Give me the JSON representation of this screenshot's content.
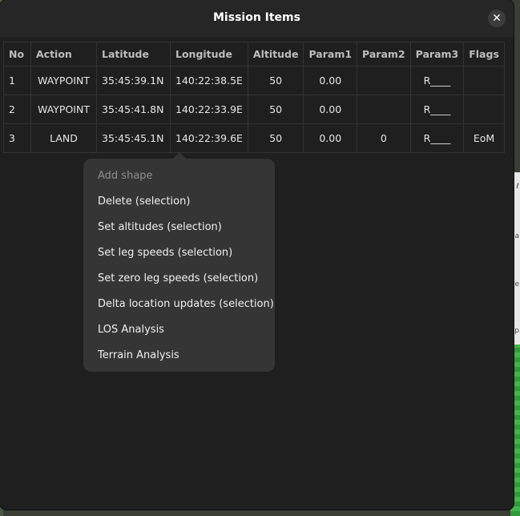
{
  "dialog": {
    "title": "Mission Items",
    "close_glyph": "✕"
  },
  "table": {
    "headers": [
      "No",
      "Action",
      "Latitude",
      "Longitude",
      "Altitude",
      "Param1",
      "Param2",
      "Param3",
      "Flags"
    ],
    "rows": [
      [
        "1",
        "WAYPOINT",
        "35:45:39.1N",
        "140:22:38.5E",
        "50",
        "0.00",
        "",
        "R____",
        ""
      ],
      [
        "2",
        "WAYPOINT",
        "35:45:41.8N",
        "140:22:33.9E",
        "50",
        "0.00",
        "",
        "R____",
        ""
      ],
      [
        "3",
        "LAND",
        "35:45:45.1N",
        "140:22:39.6E",
        "50",
        "0.00",
        "0",
        "R____",
        "EoM"
      ]
    ]
  },
  "context_menu": {
    "items": [
      "Add shape",
      "Delete (selection)",
      "Set altitudes (selection)",
      "Set leg speeds  (selection)",
      "Set zero leg speeds (selection)",
      "Delta location updates (selection)",
      "LOS Analysis",
      "Terrain Analysis"
    ],
    "disabled_item": "Add shape"
  },
  "background": {
    "side_glyphs": [
      "ℓ",
      "a",
      "e",
      "p"
    ]
  },
  "colors": {
    "dialog_bg": "#1f1f1f",
    "menu_bg": "#353535",
    "text": "#e6e6e6",
    "disabled_text": "#8e8e8e"
  }
}
